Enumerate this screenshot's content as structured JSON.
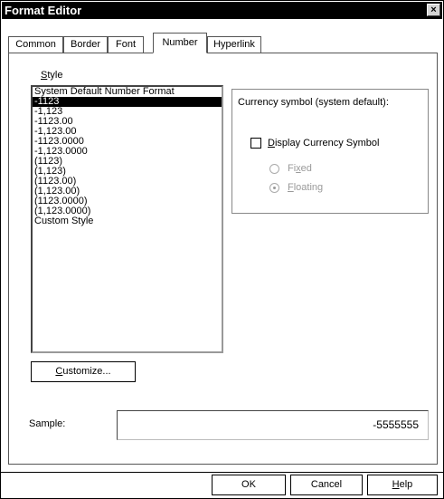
{
  "window": {
    "title": "Format Editor",
    "close_glyph": "×"
  },
  "tabs": [
    {
      "label": "Common"
    },
    {
      "label": "Border"
    },
    {
      "label": "Font"
    },
    {
      "label": "Number",
      "active": true
    },
    {
      "label": "Hyperlink"
    }
  ],
  "style_section": {
    "label_underlined_char": "S",
    "label_rest": "tyle",
    "items": [
      "System Default Number Format",
      "-1123",
      "-1,123",
      "-1123.00",
      "-1,123.00",
      "-1123.0000",
      "-1,123.0000",
      "(1123)",
      "(1,123)",
      "(1123.00)",
      "(1,123.00)",
      "(1123.0000)",
      "(1,123.0000)",
      "Custom Style"
    ],
    "selected_item": "-1123"
  },
  "currency": {
    "group_label": "Currency symbol (system default):",
    "display_underlined_char": "D",
    "display_rest": "isplay Currency Symbol",
    "display_checked": false,
    "fixed_pre": "Fi",
    "fixed_underlined_char": "x",
    "fixed_post": "ed",
    "floating_underlined_char": "F",
    "floating_rest": "loating",
    "selected_position": "Floating"
  },
  "customize_button": {
    "underlined_char": "C",
    "rest": "ustomize..."
  },
  "sample": {
    "label": "Sample:",
    "value": "-5555555"
  },
  "footer": {
    "ok": "OK",
    "cancel": "Cancel",
    "help_underlined_char": "H",
    "help_rest": "elp"
  }
}
